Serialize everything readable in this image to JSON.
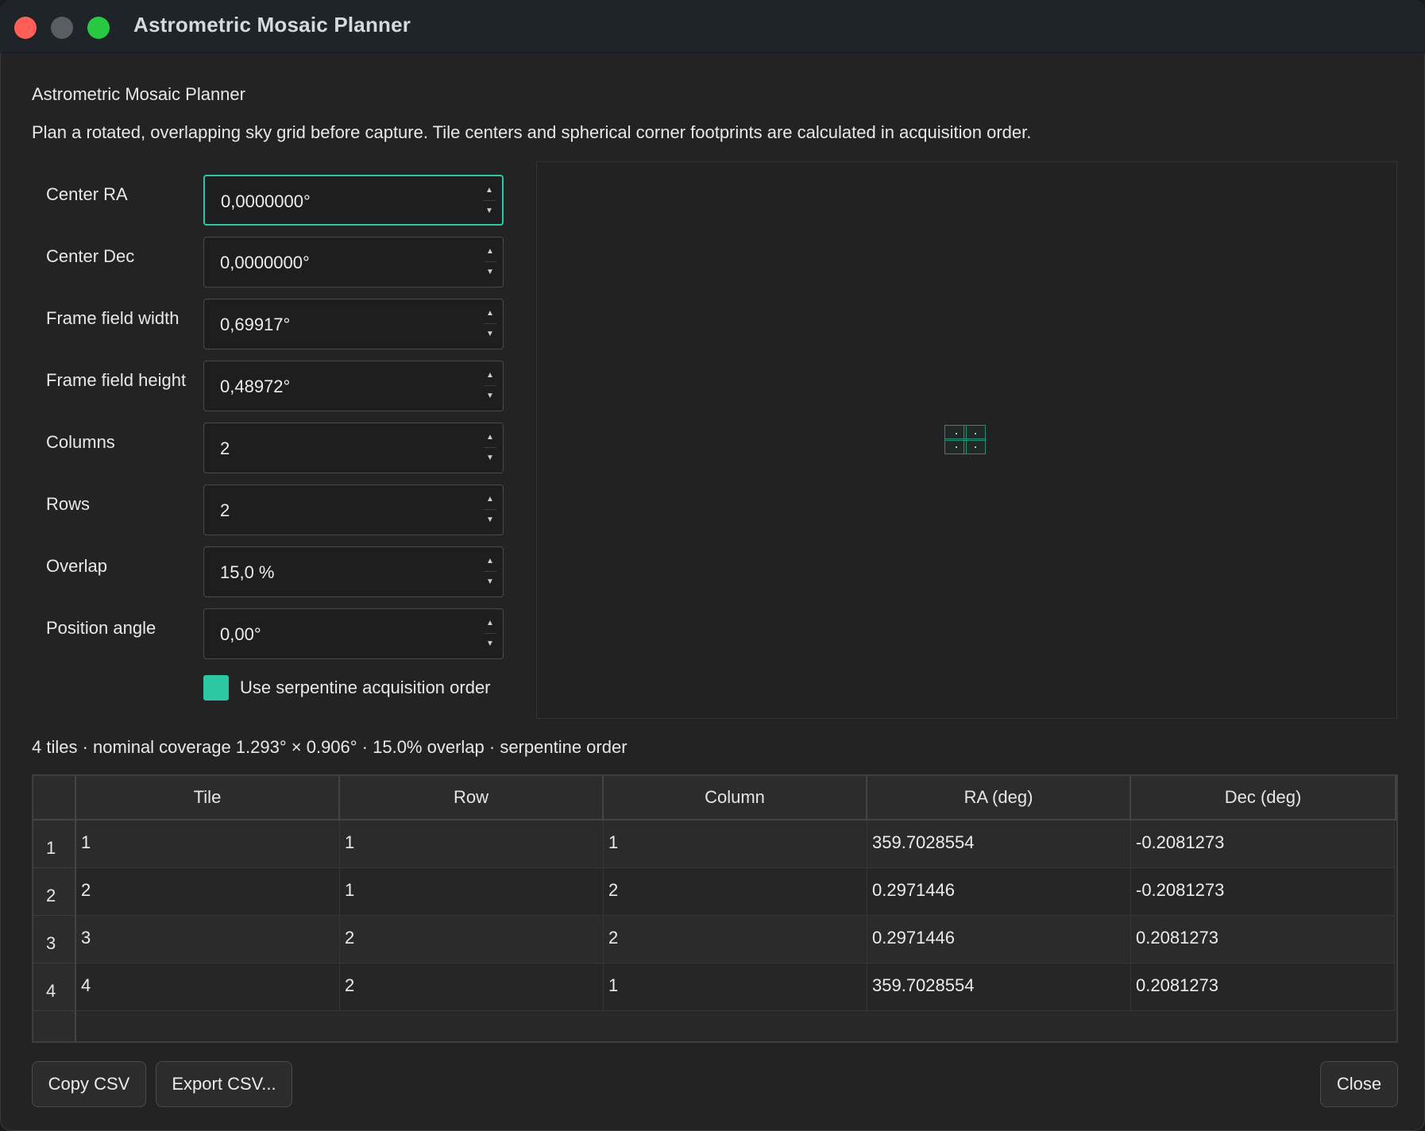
{
  "window": {
    "title": "Astrometric Mosaic Planner"
  },
  "heading": "Astrometric Mosaic Planner",
  "description": "Plan a rotated, overlapping sky grid before capture. Tile centers and spherical corner footprints are calculated in acquisition order.",
  "form": {
    "center_ra": {
      "label": "Center RA",
      "value": "0,0000000°"
    },
    "center_dec": {
      "label": "Center Dec",
      "value": "0,0000000°"
    },
    "frame_width": {
      "label": "Frame field width",
      "value": "0,69917°"
    },
    "frame_height": {
      "label": "Frame field height",
      "value": "0,48972°"
    },
    "columns": {
      "label": "Columns",
      "value": "2"
    },
    "rows": {
      "label": "Rows",
      "value": "2"
    },
    "overlap": {
      "label": "Overlap",
      "value": "15,0 %"
    },
    "position_angle": {
      "label": "Position angle",
      "value": "0,00°"
    },
    "serpentine": {
      "label": "Use serpentine acquisition order",
      "checked": true
    }
  },
  "summary": "4 tiles · nominal coverage 1.293° × 0.906° · 15.0% overlap · serpentine order",
  "table": {
    "headers": [
      "Tile",
      "Row",
      "Column",
      "RA (deg)",
      "Dec (deg)"
    ],
    "row_headers": [
      "1",
      "2",
      "3",
      "4"
    ],
    "rows": [
      [
        "1",
        "1",
        "1",
        "359.7028554",
        "-0.2081273"
      ],
      [
        "2",
        "1",
        "2",
        "0.2971446",
        "-0.2081273"
      ],
      [
        "3",
        "2",
        "2",
        "0.2971446",
        "0.2081273"
      ],
      [
        "4",
        "2",
        "1",
        "359.7028554",
        "0.2081273"
      ]
    ]
  },
  "buttons": {
    "copy_csv": "Copy CSV",
    "export_csv": "Export CSV...",
    "close": "Close"
  },
  "colors": {
    "accent": "#2ec7a4",
    "close_light": "#ff5f57",
    "zoom_light": "#28c840"
  }
}
